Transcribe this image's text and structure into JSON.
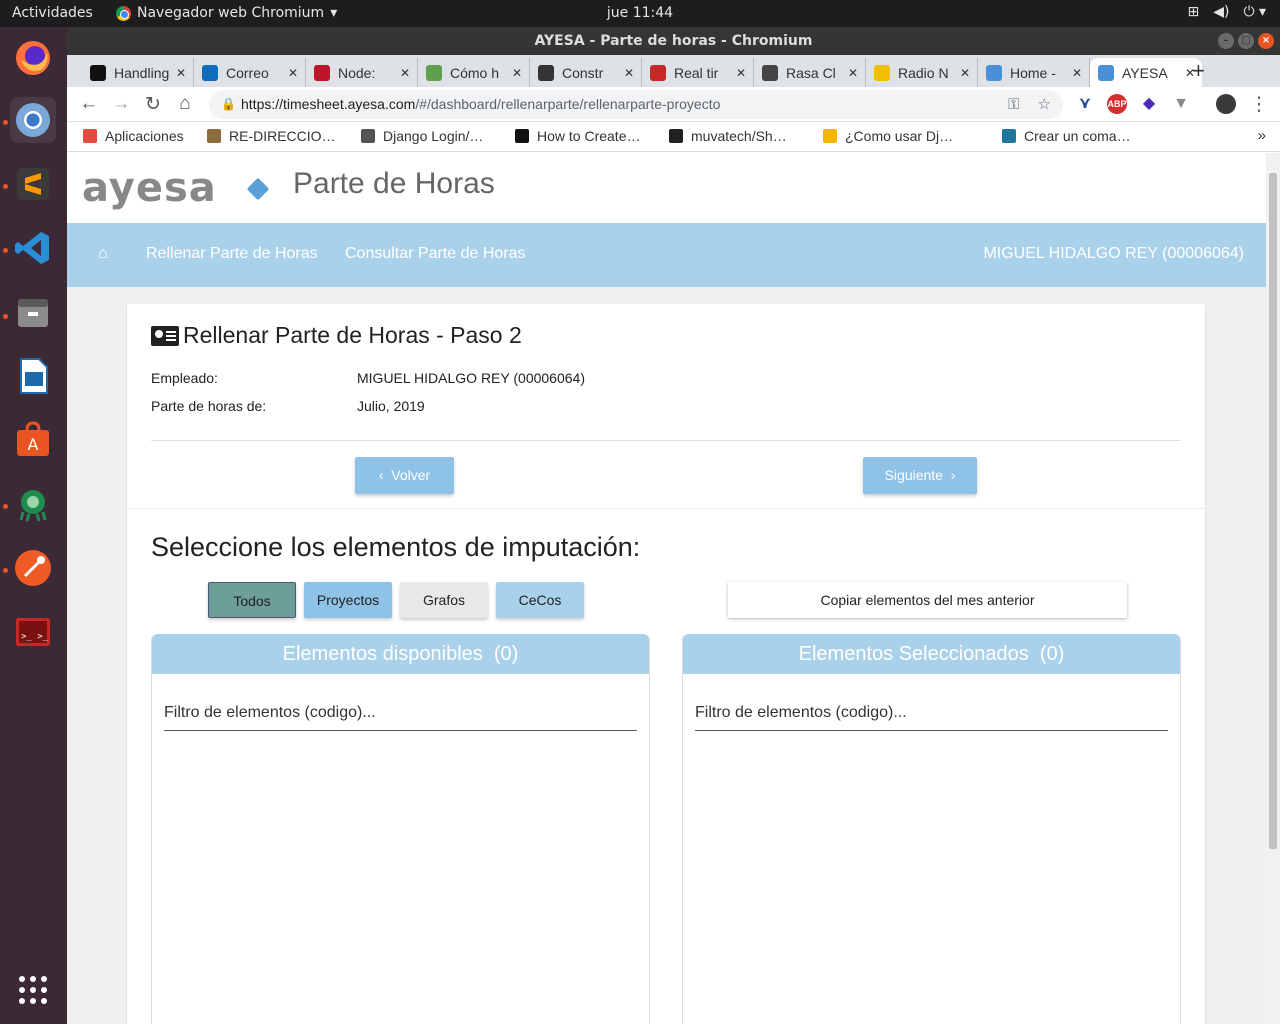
{
  "os": {
    "activities": "Actividades",
    "app_name": "Navegador web Chromium",
    "clock": "jue 11:44"
  },
  "window": {
    "title": "AYESA - Parte de horas - Chromium"
  },
  "tabs": [
    {
      "label": "Handling",
      "color": "#111111"
    },
    {
      "label": "Correo",
      "color": "#0f6cbd"
    },
    {
      "label": "Node:",
      "color": "#c0142c"
    },
    {
      "label": "Cómo h",
      "color": "#5fa04e"
    },
    {
      "label": "Constr",
      "color": "#333333"
    },
    {
      "label": "Real tir",
      "color": "#c62828"
    },
    {
      "label": "Rasa Cl",
      "color": "#444444"
    },
    {
      "label": "Radio N",
      "color": "#f1bf00"
    },
    {
      "label": "Home -",
      "color": "#4a90d9"
    },
    {
      "label": "AYESA",
      "color": "#4a90d9",
      "active": true
    }
  ],
  "address": {
    "host": "https://timesheet.ayesa.com",
    "path": "/#/dashboard/rellenarparte/rellenarparte-proyecto"
  },
  "bookmarks": [
    {
      "label": "Aplicaciones",
      "color": "#e04a3f"
    },
    {
      "label": "RE-DIRECCIO…",
      "color": "#8a6d3b"
    },
    {
      "label": "Django Login/…",
      "color": "#555555"
    },
    {
      "label": "How to Create…",
      "color": "#111111"
    },
    {
      "label": "muvatech/Sh…",
      "color": "#222222"
    },
    {
      "label": "¿Como usar Dj…",
      "color": "#f4b400"
    },
    {
      "label": "Crear un coma…",
      "color": "#21759b"
    }
  ],
  "brand": {
    "logo_text": "ayesa",
    "title": "Parte de Horas"
  },
  "nav": {
    "item1": "Rellenar Parte de Horas",
    "item2": "Consultar Parte de Horas",
    "user": "MIGUEL HIDALGO REY (00006064)"
  },
  "form": {
    "title": "Rellenar Parte de Horas - Paso 2",
    "employee_label": "Empleado:",
    "employee_value": "MIGUEL HIDALGO REY (00006064)",
    "period_label": "Parte de horas de:",
    "period_value": "Julio, 2019",
    "prev_label": "Volver",
    "next_label": "Siguiente"
  },
  "selection": {
    "title": "Seleccione los elementos de imputación:",
    "filters": [
      {
        "label": "Todos",
        "color": "#6d9e9a"
      },
      {
        "label": "Proyectos",
        "color": "#8ec2e6"
      },
      {
        "label": "Grafos",
        "color": "#e8e8e8"
      },
      {
        "label": "CeCos",
        "color": "#a9d1ea"
      }
    ],
    "copy_label": "Copiar elementos del mes anterior",
    "available": {
      "title": "Elementos disponibles",
      "count": "(0)",
      "filter_placeholder": "Filtro de elementos (codigo)..."
    },
    "selected": {
      "title": "Elementos Seleccionados",
      "count": "(0)",
      "filter_placeholder": "Filtro de elementos (codigo)..."
    }
  }
}
